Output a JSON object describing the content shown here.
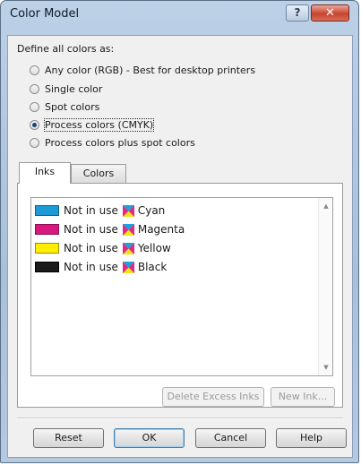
{
  "window": {
    "title": "Color Model"
  },
  "titlebar": {
    "help_glyph": "?",
    "close_glyph": "✕"
  },
  "define_label": "Define all colors as:",
  "options": [
    {
      "label": "Any color (RGB) - Best for desktop printers",
      "checked": false
    },
    {
      "label": "Single color",
      "checked": false
    },
    {
      "label": "Spot colors",
      "checked": false
    },
    {
      "label": "Process colors (CMYK)",
      "checked": true
    },
    {
      "label": "Process colors plus spot colors",
      "checked": false
    }
  ],
  "tabs": [
    {
      "label": "Inks",
      "active": true
    },
    {
      "label": "Colors",
      "active": false
    }
  ],
  "inks": [
    {
      "status": "Not in use",
      "name": "Cyan",
      "color": "#1b9ad6"
    },
    {
      "status": "Not in use",
      "name": "Magenta",
      "color": "#d9187e"
    },
    {
      "status": "Not in use",
      "name": "Yellow",
      "color": "#ffee00"
    },
    {
      "status": "Not in use",
      "name": "Black",
      "color": "#1a1a1a"
    }
  ],
  "panel_buttons": {
    "delete_excess": "Delete Excess Inks",
    "new_ink": "New Ink..."
  },
  "footer_buttons": {
    "reset": "Reset",
    "ok": "OK",
    "cancel": "Cancel",
    "help": "Help"
  }
}
